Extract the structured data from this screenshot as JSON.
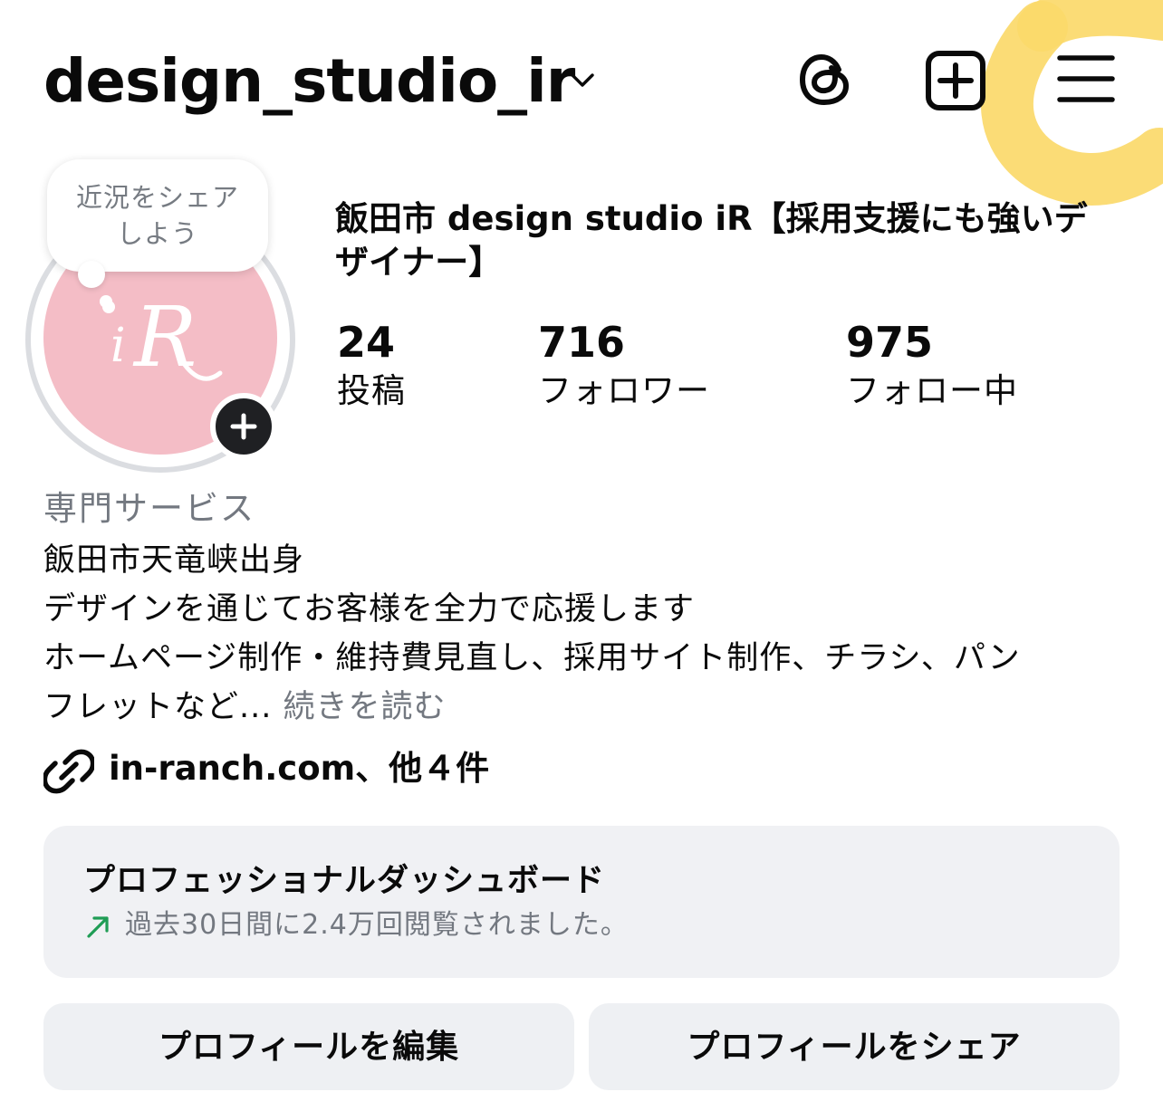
{
  "header": {
    "username": "design_studio_ir",
    "icons": {
      "switch_account": "chevron-down-icon",
      "threads": "threads-icon",
      "create": "plus-square-icon",
      "menu": "hamburger-menu-icon"
    }
  },
  "avatar": {
    "logo_text": "iR",
    "background_color": "#f4bdc6",
    "note_text": "近況をシェア しよう",
    "note_line_1": "近況をシェア",
    "note_line_2": "しよう"
  },
  "profile": {
    "display_name": "飯田市 design studio iR【採用支援にも強いデザイナー】",
    "stats": [
      {
        "value": "24",
        "label": "投稿"
      },
      {
        "value": "716",
        "label": "フォロワー"
      },
      {
        "value": "975",
        "label": "フォロー中"
      }
    ],
    "category": "専門サービス",
    "bio_lines": [
      "飯田市天竜峡出身",
      "デザインを通じてお客様を全力で応援します",
      "ホームページ制作・維持費見直し、採用サイト制作、チラシ、パン",
      "フレットなど..."
    ],
    "bio_more": " 続きを読む",
    "link_text": "in-ranch.com、他４件"
  },
  "dashboard": {
    "title": "プロフェッショナルダッシュボード",
    "subtitle": "過去30日間に2.4万回閲覧されました。",
    "trend_color": "#1f9d55"
  },
  "buttons": {
    "edit_profile": "プロフィールを編集",
    "share_profile": "プロフィールをシェア"
  },
  "colors": {
    "highlight": "#fbd96a",
    "secondary_text": "#737880",
    "card_background": "#f0f1f4"
  }
}
